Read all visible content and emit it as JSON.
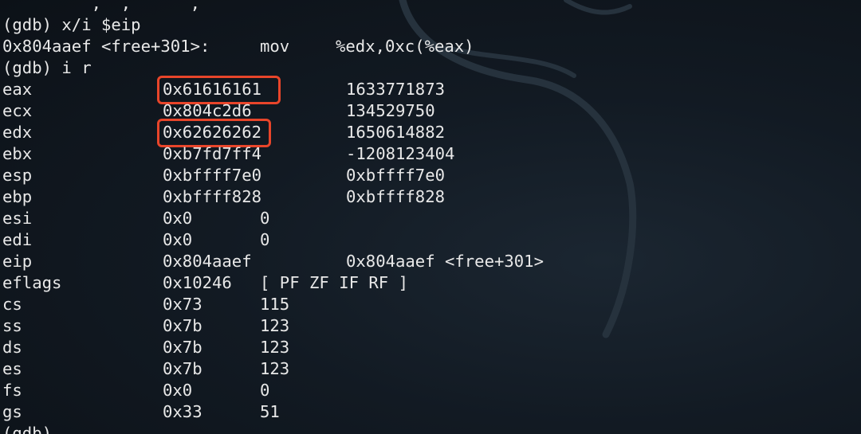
{
  "terminal": {
    "partial_top_line": "         ,  ,      ,",
    "cmd_x_i": "(gdb) x/i $eip",
    "instr": {
      "addr": "0x804aaef <free+301>:",
      "mnemonic": "mov",
      "operands": "%edx,0xc(%eax)"
    },
    "cmd_info_regs": "(gdb) i r",
    "registers": [
      {
        "name": "eax",
        "hex": "0x61616161",
        "value": "1633771873",
        "highlight": true
      },
      {
        "name": "ecx",
        "hex": "0x804c2d6",
        "value": "134529750",
        "highlight": false
      },
      {
        "name": "edx",
        "hex": "0x62626262",
        "value": "1650614882",
        "highlight": true
      },
      {
        "name": "ebx",
        "hex": "0xb7fd7ff4",
        "value": "-1208123404",
        "highlight": false
      },
      {
        "name": "esp",
        "hex": "0xbffff7e0",
        "value": "0xbffff7e0",
        "highlight": false
      },
      {
        "name": "ebp",
        "hex": "0xbffff828",
        "value": "0xbffff828",
        "highlight": false
      },
      {
        "name": "esi",
        "hex": "0x0",
        "value": "0",
        "highlight": false
      },
      {
        "name": "edi",
        "hex": "0x0",
        "value": "0",
        "highlight": false
      },
      {
        "name": "eip",
        "hex": "0x804aaef",
        "value": "0x804aaef <free+301>",
        "highlight": false
      },
      {
        "name": "eflags",
        "hex": "0x10246",
        "value": "[ PF ZF IF RF ]",
        "highlight": false
      },
      {
        "name": "cs",
        "hex": "0x73",
        "value": "115",
        "highlight": false
      },
      {
        "name": "ss",
        "hex": "0x7b",
        "value": "123",
        "highlight": false
      },
      {
        "name": "ds",
        "hex": "0x7b",
        "value": "123",
        "highlight": false
      },
      {
        "name": "es",
        "hex": "0x7b",
        "value": "123",
        "highlight": false
      },
      {
        "name": "fs",
        "hex": "0x0",
        "value": "0",
        "highlight": false
      },
      {
        "name": "gs",
        "hex": "0x33",
        "value": "51",
        "highlight": false
      }
    ],
    "prompt": "(gdb)"
  },
  "colors": {
    "text": "#e8e8e8",
    "highlight_box": "#e8452a",
    "background": "#121a23"
  },
  "background_icon": "kali-dragon-watermark"
}
